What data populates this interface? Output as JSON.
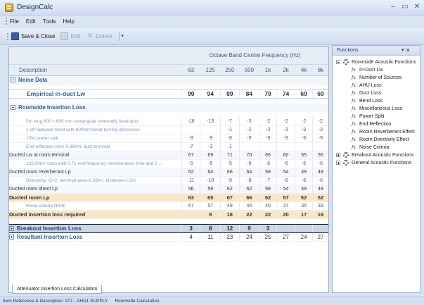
{
  "window": {
    "title": "DesignCalc",
    "minimize": "–",
    "maximize": "▭",
    "close": "✕"
  },
  "menu": [
    "File",
    "Edit",
    "Tools",
    "Help"
  ],
  "toolbar": {
    "save_close": "Save & Close",
    "edit": "Edit",
    "delete": "Delete"
  },
  "table": {
    "group_header": "Octave Band Centre Frequency (Hz)",
    "desc_header": "Description",
    "bands": [
      "63",
      "125",
      "250",
      "500",
      "1k",
      "2k",
      "4k",
      "8k"
    ]
  },
  "noise": {
    "title": "Noise Data",
    "empirical_label": "Empirical in-duct Lw",
    "empirical_values": [
      "99",
      "94",
      "89",
      "84",
      "79",
      "74",
      "69",
      "69"
    ]
  },
  "roomside": {
    "title": "Roomside Insertion Loss",
    "rows": [
      {
        "label": "5m long 600 x 600 mm rectangular externally lined duct",
        "values": [
          "-16",
          "-13",
          "-7",
          "-3",
          "-2",
          "-2",
          "-2",
          "-2"
        ]
      },
      {
        "label": "1 off radiused bend with 600mm bend turning dimension",
        "values": [
          "",
          "",
          "-1",
          "-2",
          "-3",
          "-3",
          "-3",
          "-3"
        ]
      },
      {
        "label": "13% power split",
        "values": [
          "-9",
          "-9",
          "-9",
          "-9",
          "-9",
          "-9",
          "-9",
          "-9"
        ]
      },
      {
        "label": "End reflection from 0.360m² duct terminal",
        "values": [
          "-7",
          "-3",
          "-1",
          "",
          "",
          "",
          "",
          ""
        ]
      },
      {
        "label": "Ducted Lw at room terminal",
        "values": [
          "67",
          "69",
          "71",
          "70",
          "65",
          "60",
          "55",
          "55"
        ]
      },
      {
        "label": "135.00m³ room with 0.7s mid-frequency reverberation time and 2 ...",
        "values": [
          "-5",
          "-5",
          "-5",
          "-6",
          "-6",
          "-6",
          "-6",
          "-6"
        ]
      },
      {
        "label": "Ducted room reverberant Lp",
        "values": [
          "62",
          "64",
          "66",
          "64",
          "59",
          "54",
          "49",
          "49"
        ]
      },
      {
        "label": "Directivity: Q=2, terminal area=0.36m², distance=1.5m",
        "values": [
          "-11",
          "-10",
          "-9",
          "-8",
          "-7",
          "-6",
          "-6",
          "-6"
        ]
      },
      {
        "label": "Ducted room direct Lp",
        "values": [
          "56",
          "59",
          "62",
          "62",
          "58",
          "54",
          "49",
          "49"
        ]
      },
      {
        "label": "Ducted room Lp",
        "values": [
          "63",
          "65",
          "67",
          "66",
          "62",
          "57",
          "52",
          "52"
        ]
      },
      {
        "label": "Noise criteria NR40",
        "values": [
          "67",
          "57",
          "49",
          "44",
          "40",
          "37",
          "35",
          "33"
        ]
      },
      {
        "label": "Ducted insertion loss required",
        "values": [
          "",
          "8",
          "18",
          "22",
          "22",
          "20",
          "17",
          "19"
        ]
      }
    ]
  },
  "breakout": {
    "title": "Breakout Insertion Loss",
    "values": [
      "3",
      "8",
      "12",
      "9",
      "3",
      "",
      "",
      ""
    ]
  },
  "resultant": {
    "title": "Resultant Insertion Loss",
    "values": [
      "4",
      "11",
      "23",
      "24",
      "25",
      "27",
      "24",
      "27"
    ]
  },
  "bottom_tab": "Attenuator Insertion Loss Calculation",
  "functions_panel": {
    "title": "Functions",
    "pin": "▾  ⇲",
    "root": "Roomside Acoustic Functions",
    "items": [
      "In-Duct Lw",
      "Number of Sources",
      "AHU Loss",
      "Duct Loss",
      "Bend Loss",
      "Miscellaneous Loss",
      "Power Split",
      "End Reflection",
      "Room Reverberant Effect",
      "Room Directivity Effect",
      "Noise Criteria"
    ],
    "other_roots": [
      "Breakout Acoustic Functions",
      "General Acoustic Functions"
    ],
    "fx_glyph": "fx"
  },
  "status": {
    "item_ref": "Item Reference & Description: AT1 - AHU1 SUPPLY",
    "calc": "Roomside Calculation"
  },
  "colors": {
    "highlight": "#fbe7c6",
    "section": "#2f5c98",
    "breakout": "#c9d7ea"
  }
}
